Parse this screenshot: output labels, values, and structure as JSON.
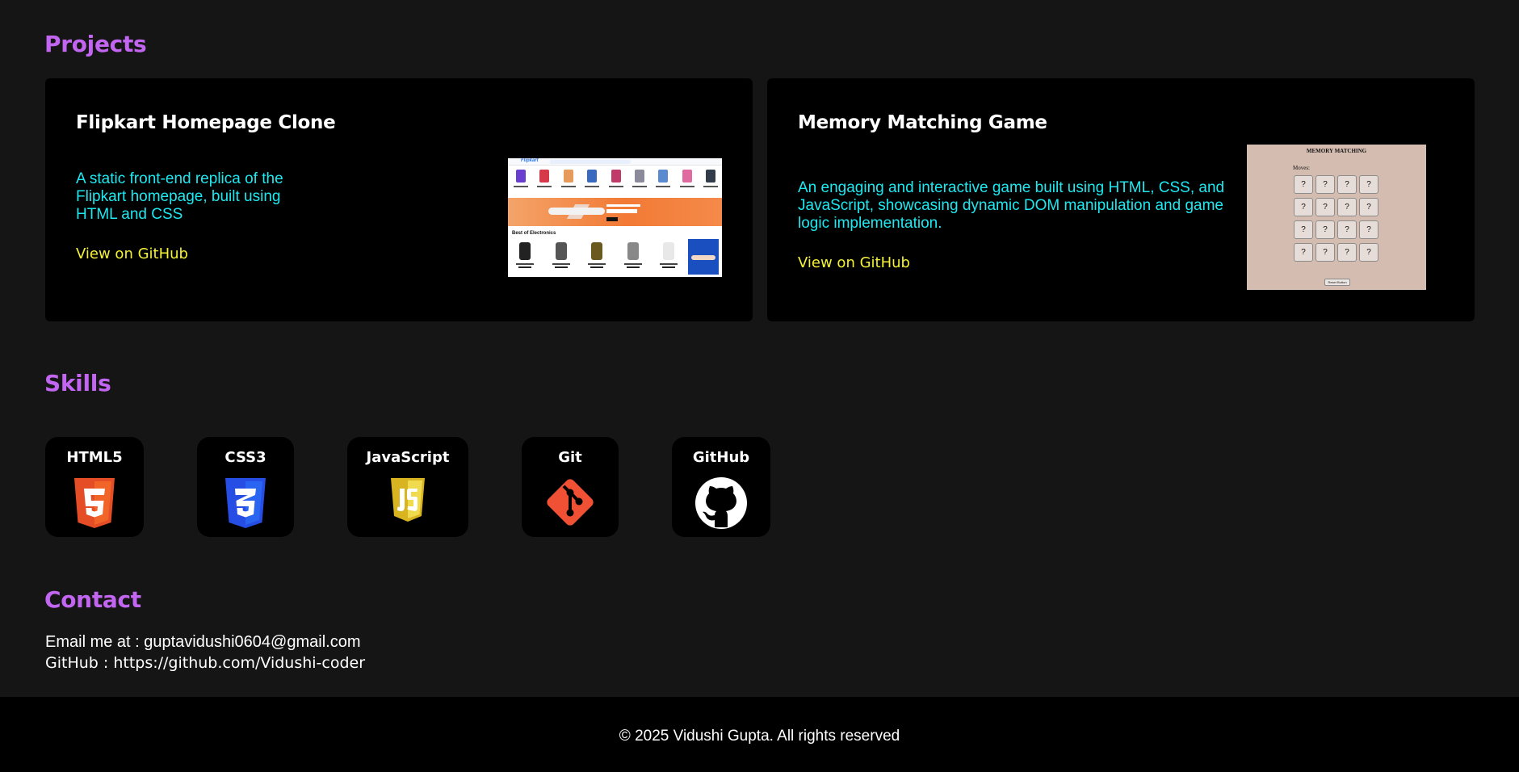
{
  "sections": {
    "projects": "Projects",
    "skills": "Skills",
    "contact": "Contact"
  },
  "projects": [
    {
      "title": "Flipkart Homepage Clone",
      "description": "A static front-end replica of the Flipkart homepage, built using HTML and CSS",
      "link": "View on GitHub",
      "preview_logo": "Flipkart",
      "preview_section": "Best of Electronics"
    },
    {
      "title": "Memory Matching Game",
      "description": "An engaging and interactive game built using HTML, CSS, and JavaScript, showcasing dynamic DOM manipulation and game logic implementation.",
      "link": "View on GitHub",
      "preview_title": "MEMORY MATCHING",
      "preview_moves": "Moves:",
      "preview_tile": "?",
      "preview_reset": "Reset Button"
    }
  ],
  "skills": [
    {
      "name": "HTML5",
      "icon": "html5-icon",
      "color": "#e44d26"
    },
    {
      "name": "CSS3",
      "icon": "css3-icon",
      "color": "#264de4"
    },
    {
      "name": "JavaScript",
      "icon": "javascript-icon",
      "color": "#f0db4f"
    },
    {
      "name": "Git",
      "icon": "git-icon",
      "color": "#f05033"
    },
    {
      "name": "GitHub",
      "icon": "github-icon",
      "color": "#ffffff"
    }
  ],
  "contact": {
    "email": "Email me at : guptavidushi0604@gmail.com",
    "github": "GitHub : https://github.com/Vidushi-coder"
  },
  "footer": {
    "text": "© 2025 Vidushi Gupta. All rights reserved"
  },
  "colors": {
    "background": "#151515",
    "card": "#000000",
    "heading": "#c266f2",
    "description": "#1ee8f0",
    "link": "#f5f234"
  }
}
